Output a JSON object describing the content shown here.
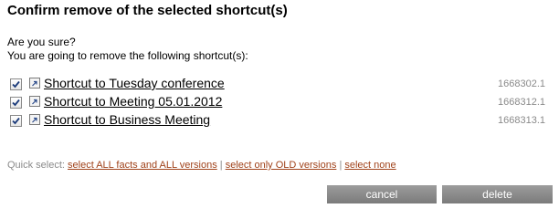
{
  "dialog": {
    "title": "Confirm remove of the selected shortcut(s)",
    "question": "Are you sure?",
    "warning": "You are going to remove the following shortcut(s):"
  },
  "shortcuts": [
    {
      "label": "Shortcut to Tuesday conference",
      "id": "1668302.1",
      "checked": true
    },
    {
      "label": "Shortcut to Meeting 05.01.2012",
      "id": "1668312.1",
      "checked": true
    },
    {
      "label": "Shortcut to Business Meeting",
      "id": "1668313.1",
      "checked": true
    }
  ],
  "quick_select": {
    "prefix": "Quick select:",
    "all_label": "select ALL facts and ALL versions",
    "old_label": "select only OLD versions",
    "none_label": "select none",
    "separator": "|"
  },
  "buttons": {
    "cancel_label": "cancel",
    "delete_label": "delete"
  },
  "colors": {
    "link_accent": "#a0421a",
    "muted_text": "#8a8a8a",
    "button_bg": "#8a8a8a"
  },
  "icons": {
    "checkbox": "checkmark-icon",
    "shortcut": "shortcut-arrow-icon"
  }
}
